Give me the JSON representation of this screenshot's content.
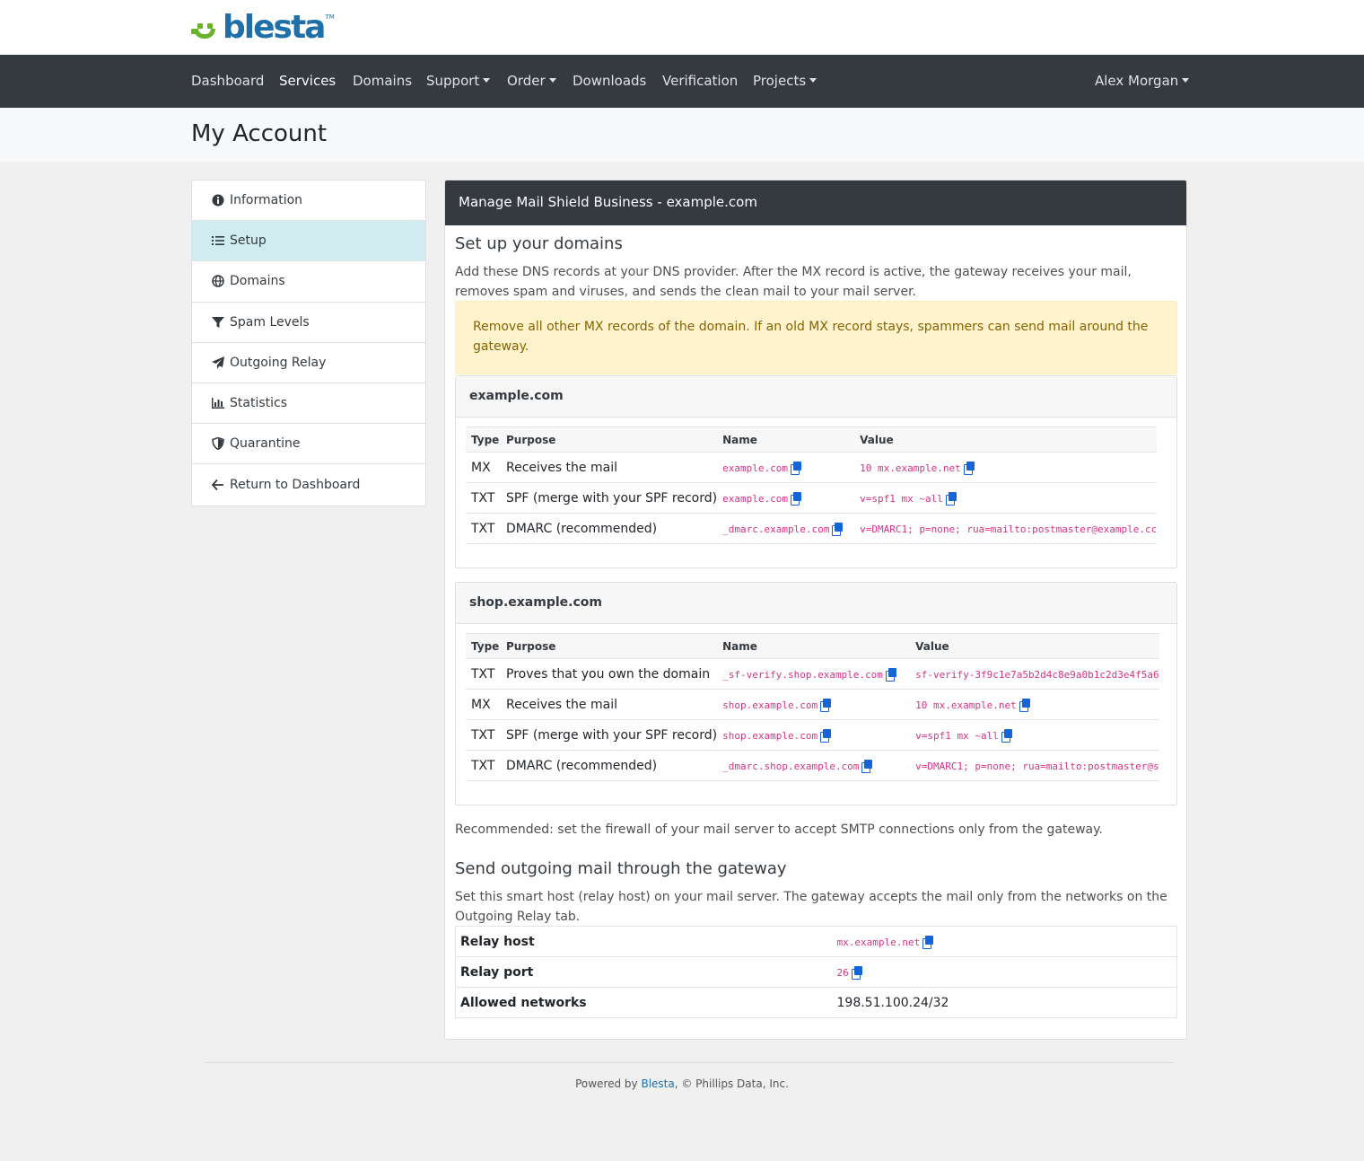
{
  "brand": {
    "name": "blesta",
    "tm": "TM",
    "colors": {
      "green": "#6ab42d",
      "blue": "#1f6fa8"
    }
  },
  "nav": {
    "items": [
      {
        "label": "Dashboard",
        "caret": false
      },
      {
        "label": "Services",
        "caret": false,
        "active": true
      },
      {
        "label": "Domains",
        "caret": false
      },
      {
        "label": "Support",
        "caret": true
      },
      {
        "label": "Order",
        "caret": true
      },
      {
        "label": "Downloads",
        "caret": false
      },
      {
        "label": "Verification",
        "caret": false
      },
      {
        "label": "Projects",
        "caret": true
      }
    ],
    "user": "Alex Morgan"
  },
  "page": {
    "title": "My Account"
  },
  "sidebar": {
    "items": [
      {
        "label": "Information",
        "icon": "info-circle-icon"
      },
      {
        "label": "Setup",
        "icon": "list-icon",
        "active": true
      },
      {
        "label": "Domains",
        "icon": "globe-icon"
      },
      {
        "label": "Spam Levels",
        "icon": "filter-icon"
      },
      {
        "label": "Outgoing Relay",
        "icon": "paper-plane-icon"
      },
      {
        "label": "Statistics",
        "icon": "bar-chart-icon"
      },
      {
        "label": "Quarantine",
        "icon": "shield-icon"
      },
      {
        "label": "Return to Dashboard",
        "icon": "arrow-left-icon"
      }
    ]
  },
  "panel": {
    "title": "Manage Mail Shield Business - example.com",
    "setup_heading": "Set up your domains",
    "setup_text": "Add these DNS records at your DNS provider. After the MX record is active, the gateway receives your mail, removes spam and viruses, and sends the clean mail to your mail server.",
    "alert": "Remove all other MX records of the domain. If an old MX record stays, spammers can send mail around the gateway.",
    "columns": {
      "type": "Type",
      "purpose": "Purpose",
      "name": "Name",
      "value": "Value"
    },
    "domains": [
      {
        "name": "example.com",
        "records": [
          {
            "type": "MX",
            "purpose": "Receives the mail",
            "name": "example.com",
            "value": "10 mx.example.net"
          },
          {
            "type": "TXT",
            "purpose": "SPF (merge with your SPF record)",
            "name": "example.com",
            "value": "v=spf1 mx ~all"
          },
          {
            "type": "TXT",
            "purpose": "DMARC (recommended)",
            "name": "_dmarc.example.com",
            "value": "v=DMARC1; p=none; rua=mailto:postmaster@example.cc"
          }
        ]
      },
      {
        "name": "shop.example.com",
        "records": [
          {
            "type": "TXT",
            "purpose": "Proves that you own the domain",
            "name": "_sf-verify.shop.example.com",
            "value": "sf-verify-3f9c1e7a5b2d4c8e9a0b1c2d3e4f5a6"
          },
          {
            "type": "MX",
            "purpose": "Receives the mail",
            "name": "shop.example.com",
            "value": "10 mx.example.net"
          },
          {
            "type": "TXT",
            "purpose": "SPF (merge with your SPF record)",
            "name": "shop.example.com",
            "value": "v=spf1 mx ~all"
          },
          {
            "type": "TXT",
            "purpose": "DMARC (recommended)",
            "name": "_dmarc.shop.example.com",
            "value": "v=DMARC1; p=none; rua=mailto:postmaster@s"
          }
        ]
      }
    ],
    "firewall_note": "Recommended: set the firewall of your mail server to accept SMTP connections only from the gateway.",
    "outgoing_heading": "Send outgoing mail through the gateway",
    "outgoing_text": "Set this smart host (relay host) on your mail server. The gateway accepts the mail only from the networks on the Outgoing Relay tab.",
    "relay": [
      {
        "label": "Relay host",
        "value": "mx.example.net",
        "code": true
      },
      {
        "label": "Relay port",
        "value": "26",
        "code": true
      },
      {
        "label": "Allowed networks",
        "value": "198.51.100.24/32",
        "code": false
      }
    ]
  },
  "footer": {
    "prefix": "Powered by ",
    "link": "Blesta",
    "suffix": ", © Phillips Data, Inc."
  }
}
